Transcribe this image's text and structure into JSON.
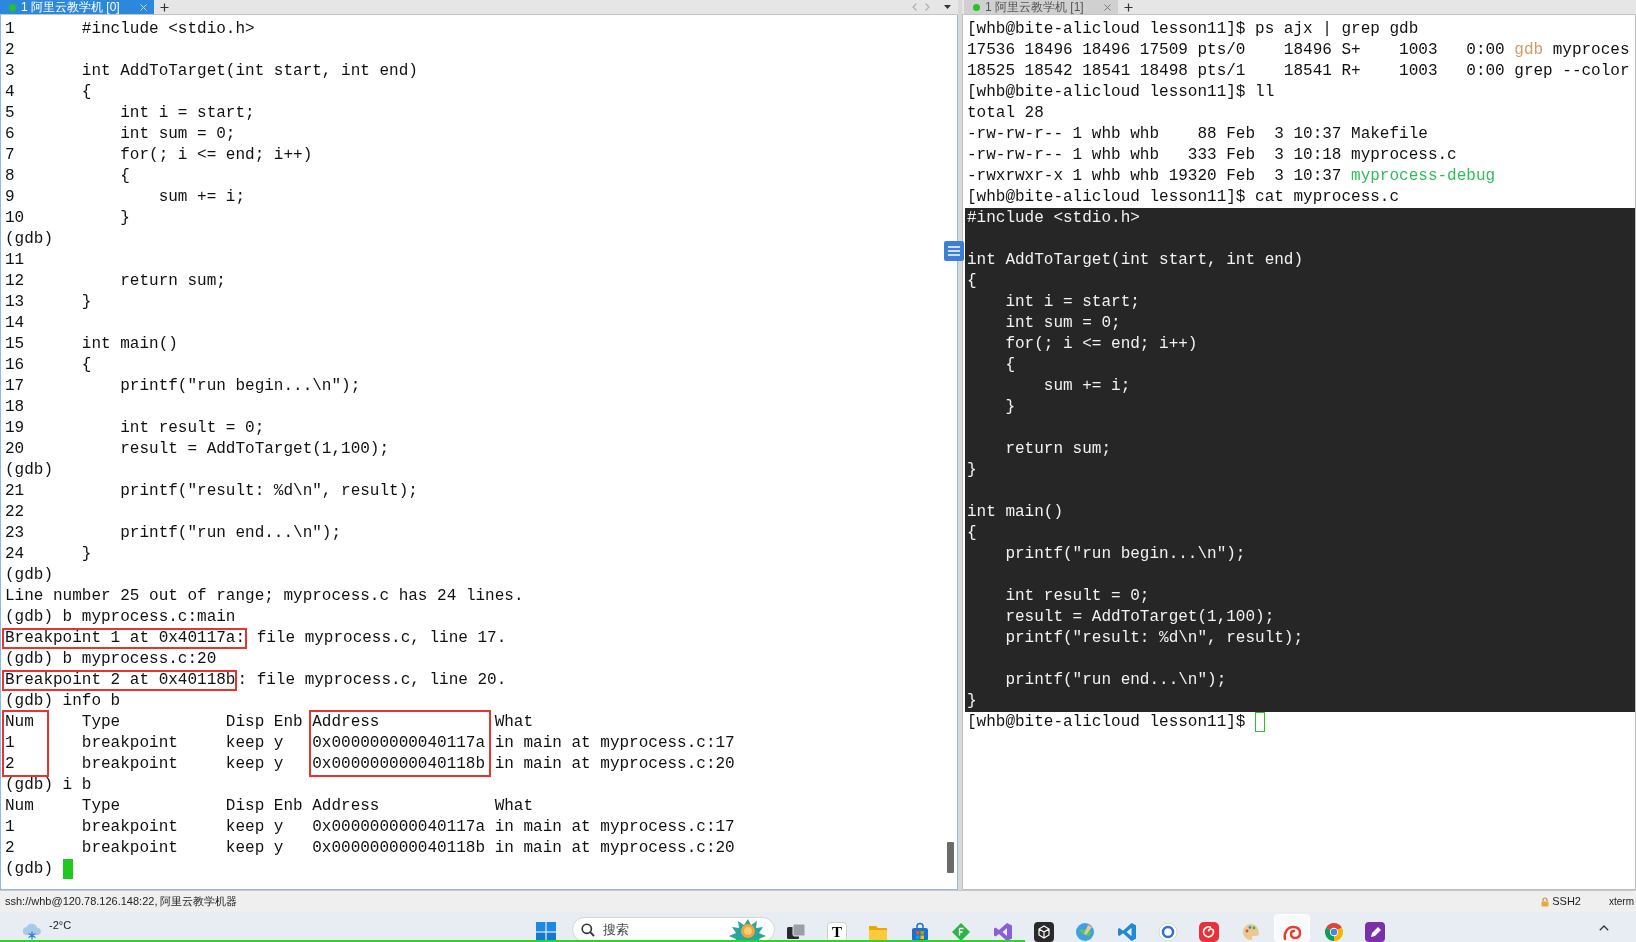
{
  "panes": [
    {
      "focused": true,
      "tab": {
        "title": "1 阿里云教学机 [0]",
        "connected": true
      },
      "lines": [
        {
          "kind": "source",
          "number": "1",
          "code": "#include <stdio.h>"
        },
        {
          "kind": "source",
          "number": "2"
        },
        {
          "kind": "source",
          "number": "3",
          "code": "int AddToTarget(int start, int end)"
        },
        {
          "kind": "source",
          "number": "4",
          "code": "{"
        },
        {
          "kind": "source",
          "number": "5",
          "code": "    int i = start;"
        },
        {
          "kind": "source",
          "number": "6",
          "code": "    int sum = 0;"
        },
        {
          "kind": "source",
          "number": "7",
          "code": "    for(; i <= end; i++)"
        },
        {
          "kind": "source",
          "number": "8",
          "code": "    {"
        },
        {
          "kind": "source",
          "number": "9",
          "code": "        sum += i;"
        },
        {
          "kind": "source",
          "number": "10",
          "code": "    }"
        },
        {
          "kind": "text",
          "text": "(gdb)"
        },
        {
          "kind": "source",
          "number": "11"
        },
        {
          "kind": "source",
          "number": "12",
          "code": "    return sum;"
        },
        {
          "kind": "source",
          "number": "13",
          "code": "}"
        },
        {
          "kind": "source",
          "number": "14"
        },
        {
          "kind": "source",
          "number": "15",
          "code": "int main()"
        },
        {
          "kind": "source",
          "number": "16",
          "code": "{"
        },
        {
          "kind": "source",
          "number": "17",
          "code": "    printf(\"run begin...\\n\");"
        },
        {
          "kind": "source",
          "number": "18"
        },
        {
          "kind": "source",
          "number": "19",
          "code": "    int result = 0;"
        },
        {
          "kind": "source",
          "number": "20",
          "code": "    result = AddToTarget(1,100);"
        },
        {
          "kind": "text",
          "text": "(gdb)"
        },
        {
          "kind": "source",
          "number": "21",
          "code": "    printf(\"result: %d\\n\", result);"
        },
        {
          "kind": "source",
          "number": "22"
        },
        {
          "kind": "source",
          "number": "23",
          "code": "    printf(\"run end...\\n\");"
        },
        {
          "kind": "source",
          "number": "24",
          "code": "}"
        },
        {
          "kind": "text",
          "text": "(gdb)"
        },
        {
          "kind": "text",
          "text": "Line number 25 out of range; myprocess.c has 24 lines."
        },
        {
          "kind": "text",
          "text": "(gdb) b myprocess.c:main"
        },
        {
          "kind": "segments",
          "segments": [
            {
              "text": "Breakpoint 1 at 0x40117a:",
              "kind": "framed"
            },
            {
              "text": " file myprocess.c, line 17.",
              "kind": "plain"
            }
          ]
        },
        {
          "kind": "text",
          "text": "(gdb) b myprocess.c:20"
        },
        {
          "kind": "segments",
          "segments": [
            {
              "text": "Breakpoint 2 at 0x40118b",
              "kind": "framed"
            },
            {
              "text": ": file myprocess.c, line 20.",
              "kind": "plain"
            }
          ]
        },
        {
          "kind": "text",
          "text": "(gdb) info b"
        },
        {
          "kind": "table",
          "columns": [
            {
              "header": "Num",
              "framed": true
            },
            {
              "header": "Type",
              "framed": false
            },
            {
              "header": "Disp",
              "framed": false
            },
            {
              "header": "Enb",
              "framed": false
            },
            {
              "header": "Address",
              "framed": true
            },
            {
              "header": "What",
              "framed": false
            }
          ],
          "rows": [
            [
              "1",
              "breakpoint",
              "keep",
              "y",
              "0x000000000040117a",
              "in main at myprocess.c:17"
            ],
            [
              "2",
              "breakpoint",
              "keep",
              "y",
              "0x000000000040118b",
              "in main at myprocess.c:20"
            ]
          ]
        },
        {
          "kind": "text",
          "text": "(gdb) i b"
        },
        {
          "kind": "table",
          "columns": [
            {
              "header": "Num",
              "framed": false
            },
            {
              "header": "Type",
              "framed": false
            },
            {
              "header": "Disp",
              "framed": false
            },
            {
              "header": "Enb",
              "framed": false
            },
            {
              "header": "Address",
              "framed": false
            },
            {
              "header": "What",
              "framed": false
            }
          ],
          "rows": [
            [
              "1",
              "breakpoint",
              "keep",
              "y",
              "0x000000000040117a",
              "in main at myprocess.c:17"
            ],
            [
              "2",
              "breakpoint",
              "keep",
              "y",
              "0x000000000040118b",
              "in main at myprocess.c:20"
            ]
          ]
        },
        {
          "kind": "text",
          "text": "(gdb)"
        }
      ]
    },
    {
      "focused": false,
      "tab": {
        "title": "1 阿里云教学机 [1]",
        "connected": true
      },
      "lines": [
        {
          "kind": "text",
          "text": "[whb@bite-alicloud lesson11]$ ps ajx | grep gdb",
          "selected": false
        },
        {
          "kind": "segments",
          "segments": [
            {
              "text": "17536 18496 18496 17509 pts/0    18496 S+    1003   0:00 ",
              "kind": "plain"
            },
            {
              "text": "gdb",
              "kind": "match"
            },
            {
              "text": " myproces",
              "kind": "plain"
            }
          ],
          "selected": false
        },
        {
          "kind": "text",
          "text": "18525 18542 18541 18498 pts/1    18541 R+    1003   0:00 grep --color",
          "selected": false
        },
        {
          "kind": "text",
          "text": "[whb@bite-alicloud lesson11]$ ll",
          "selected": false
        },
        {
          "kind": "text",
          "text": "total 28",
          "selected": false
        },
        {
          "kind": "text",
          "text": "-rw-rw-r-- 1 whb whb    88 Feb  3 10:37 Makefile",
          "selected": false
        },
        {
          "kind": "text",
          "text": "-rw-rw-r-- 1 whb whb   333 Feb  3 10:18 myprocess.c",
          "selected": false
        },
        {
          "kind": "segments",
          "segments": [
            {
              "text": "-rwxrwxr-x 1 whb whb 19320 Feb  3 10:37 ",
              "kind": "plain"
            },
            {
              "text": "myprocess-debug",
              "kind": "executable"
            }
          ],
          "selected": false
        },
        {
          "kind": "text",
          "text": "[whb@bite-alicloud lesson11]$ cat myprocess.c",
          "selected": false
        },
        {
          "kind": "text",
          "text": "#include <stdio.h>",
          "selected": true
        },
        {
          "kind": "blank",
          "selected": true
        },
        {
          "kind": "text",
          "text": "int AddToTarget(int start, int end)",
          "selected": true
        },
        {
          "kind": "text",
          "text": "{",
          "selected": true
        },
        {
          "kind": "text",
          "text": "    int i = start;",
          "selected": true
        },
        {
          "kind": "text",
          "text": "    int sum = 0;",
          "selected": true
        },
        {
          "kind": "text",
          "text": "    for(; i <= end; i++)",
          "selected": true
        },
        {
          "kind": "text",
          "text": "    {",
          "selected": true
        },
        {
          "kind": "text",
          "text": "        sum += i;",
          "selected": true
        },
        {
          "kind": "text",
          "text": "    }",
          "selected": true
        },
        {
          "kind": "blank",
          "selected": true
        },
        {
          "kind": "text",
          "text": "    return sum;",
          "selected": true
        },
        {
          "kind": "text",
          "text": "}",
          "selected": true
        },
        {
          "kind": "blank",
          "selected": true
        },
        {
          "kind": "text",
          "text": "int main()",
          "selected": true
        },
        {
          "kind": "text",
          "text": "{",
          "selected": true
        },
        {
          "kind": "text",
          "text": "    printf(\"run begin...\\n\");",
          "selected": true
        },
        {
          "kind": "blank",
          "selected": true
        },
        {
          "kind": "text",
          "text": "    int result = 0;",
          "selected": true
        },
        {
          "kind": "text",
          "text": "    result = AddToTarget(1,100);",
          "selected": true
        },
        {
          "kind": "text",
          "text": "    printf(\"result: %d\\n\", result);",
          "selected": true
        },
        {
          "kind": "blank",
          "selected": true
        },
        {
          "kind": "text",
          "text": "    printf(\"run end...\\n\");",
          "selected": true
        },
        {
          "kind": "text",
          "text": "}",
          "selected": true
        },
        {
          "kind": "text",
          "text": "[whb@bite-alicloud lesson11]$",
          "selected": false
        }
      ]
    }
  ],
  "status_bar": {
    "connection": "ssh://whb@120.78.126.148:22, 阿里云教学机器",
    "protocol": "SSH2",
    "terminal": "xterm"
  },
  "taskbar": {
    "weather": {
      "temperature": "-2°C"
    },
    "search": {
      "placeholder": "搜索"
    },
    "apps": [
      {
        "kind": "task-view",
        "active": false
      },
      {
        "kind": "letter",
        "glyph": "T",
        "active": false
      },
      {
        "kind": "folder",
        "active": false
      },
      {
        "kind": "store",
        "active": false
      },
      {
        "kind": "diamond",
        "active": false
      },
      {
        "kind": "ribbon",
        "active": false
      },
      {
        "kind": "cube",
        "active": false
      },
      {
        "kind": "globe",
        "active": false
      },
      {
        "kind": "folded-ribbon",
        "active": false
      },
      {
        "kind": "ring",
        "active": false
      },
      {
        "kind": "spiral-tile",
        "active": false
      },
      {
        "kind": "palette",
        "active": false
      },
      {
        "kind": "spiral",
        "active": true
      },
      {
        "kind": "segmented-circle",
        "active": false
      },
      {
        "kind": "pen-tile",
        "active": false
      }
    ]
  }
}
